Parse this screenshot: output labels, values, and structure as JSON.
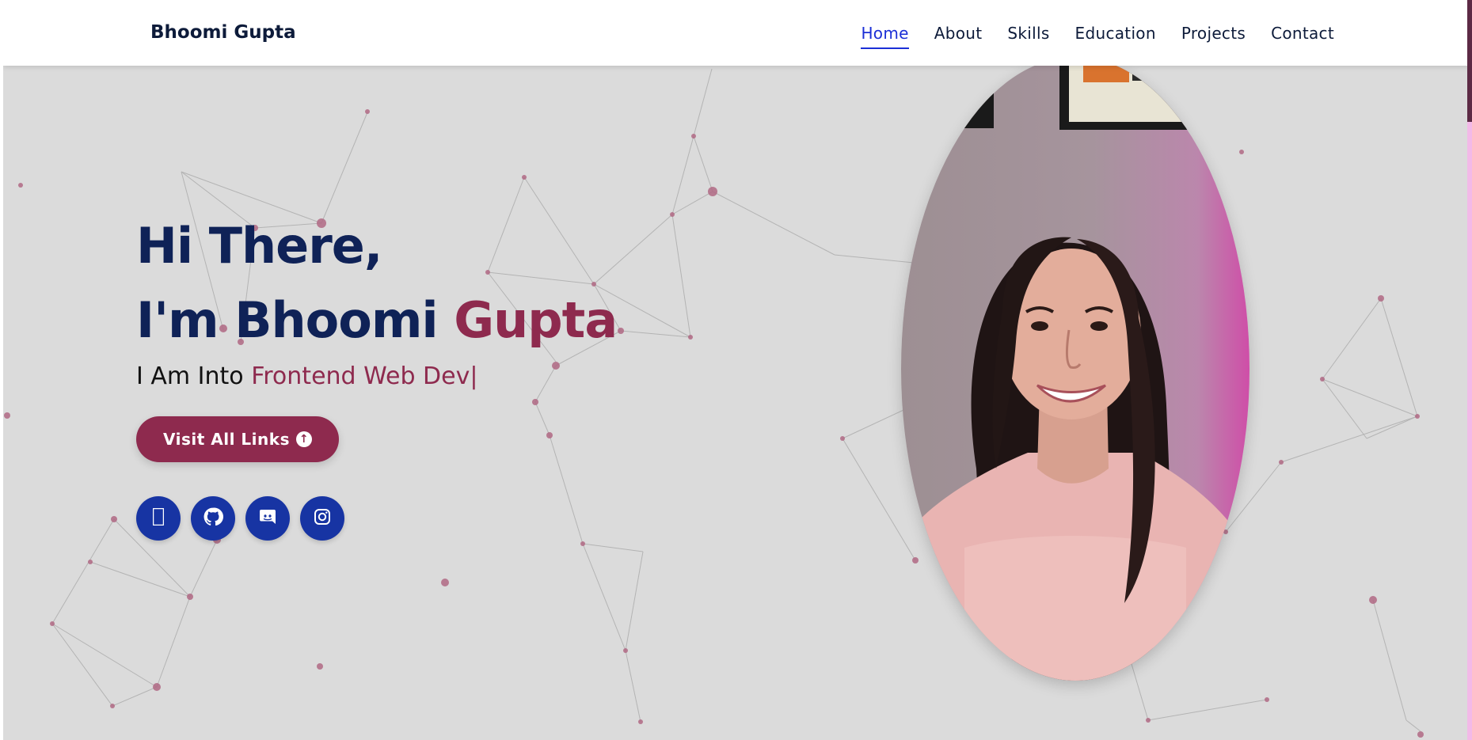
{
  "nav": {
    "brand": "Bhoomi Gupta",
    "links": [
      "Home",
      "About",
      "Skills",
      "Education",
      "Projects",
      "Contact"
    ],
    "active": "Home"
  },
  "hero": {
    "line1": "Hi There,",
    "line2_prefix": "I'm Bhoomi ",
    "line2_accent": "Gupta",
    "typed_prefix": "I Am Into ",
    "typed_accent": "Frontend Web Dev|",
    "cta_label": "Visit All Links"
  },
  "socials": [
    {
      "icon": "linkedin-icon"
    },
    {
      "icon": "github-icon"
    },
    {
      "icon": "discord-icon"
    },
    {
      "icon": "instagram-icon"
    }
  ],
  "colors": {
    "navy": "#0f2257",
    "accent": "#8e2a4e",
    "social_bg": "#1734a3",
    "active_link": "#1b2fd6",
    "background": "#dbdbdb"
  }
}
